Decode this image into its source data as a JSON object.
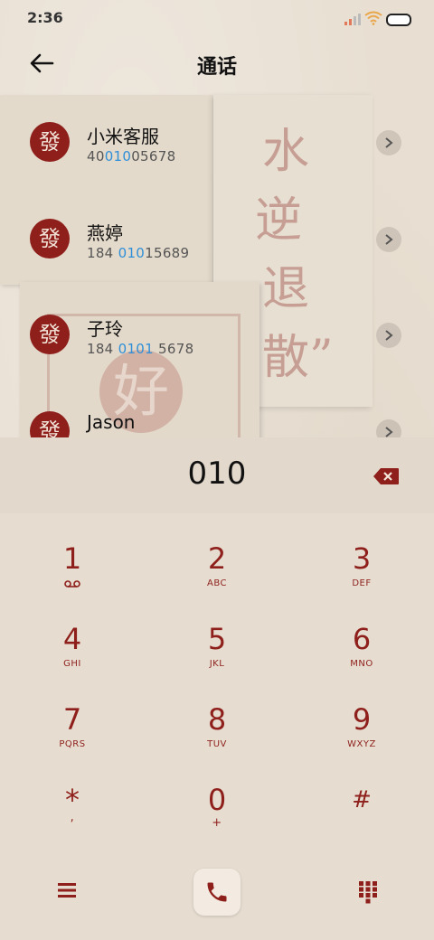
{
  "status_bar": {
    "time": "2:36"
  },
  "header": {
    "title": "通话"
  },
  "decor": {
    "calligraphy": [
      "水",
      "逆",
      "退",
      "散”"
    ],
    "seal_char": "好"
  },
  "contacts": [
    {
      "avatar": "發",
      "name": "小米客服",
      "number_pre": "40",
      "number_match": "010",
      "number_post": "05678"
    },
    {
      "avatar": "發",
      "name": "燕婷",
      "number_pre": "184 ",
      "number_match": "010",
      "number_post": "15689"
    },
    {
      "avatar": "發",
      "name": "子玲",
      "number_pre": "184 ",
      "number_match": "0101",
      "number_post": " 5678"
    },
    {
      "avatar": "發",
      "name": "Jason",
      "number_pre": "",
      "number_match": "",
      "number_post": ""
    }
  ],
  "dialer": {
    "entry": "010",
    "keys": [
      {
        "digit": "1",
        "letters": ""
      },
      {
        "digit": "2",
        "letters": "ABC"
      },
      {
        "digit": "3",
        "letters": "DEF"
      },
      {
        "digit": "4",
        "letters": "GHI"
      },
      {
        "digit": "5",
        "letters": "JKL"
      },
      {
        "digit": "6",
        "letters": "MNO"
      },
      {
        "digit": "7",
        "letters": "PQRS"
      },
      {
        "digit": "8",
        "letters": "TUV"
      },
      {
        "digit": "9",
        "letters": "WXYZ"
      },
      {
        "digit": "*",
        "letters": ","
      },
      {
        "digit": "0",
        "letters": "+"
      },
      {
        "digit": "#",
        "letters": ""
      }
    ]
  },
  "colors": {
    "accent": "#8e1f1b",
    "highlight": "#2e8fd8",
    "paper": "#e8dfd2"
  }
}
